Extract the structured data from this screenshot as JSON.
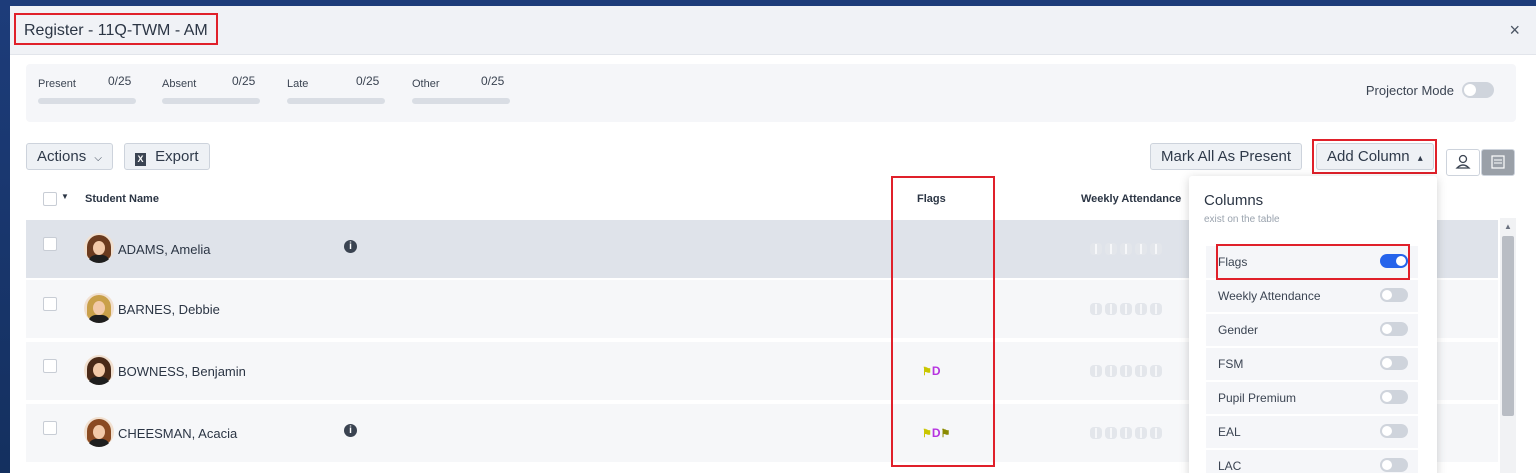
{
  "modal": {
    "title": "Register - 11Q-TWM - AM",
    "close_glyph": "×"
  },
  "stats": [
    {
      "label": "Present",
      "value": "0/25",
      "fill_fraction": 0
    },
    {
      "label": "Absent",
      "value": "0/25",
      "fill_fraction": 0
    },
    {
      "label": "Late",
      "value": "0/25",
      "fill_fraction": 0
    },
    {
      "label": "Other",
      "value": "0/25",
      "fill_fraction": 0
    }
  ],
  "projector": {
    "label": "Projector Mode",
    "enabled": false
  },
  "toolbar": {
    "actions_label": "Actions",
    "export_label": "Export",
    "mark_all_label": "Mark All As Present",
    "add_column_label": "Add Column"
  },
  "table": {
    "headers": {
      "name": "Student Name",
      "flags": "Flags",
      "weekly": "Weekly Attendance"
    },
    "rows": [
      {
        "name": "ADAMS, Amelia",
        "info": true,
        "flags": [],
        "selected": true,
        "hair": "#6b3b1f"
      },
      {
        "name": "BARNES, Debbie",
        "info": false,
        "flags": [],
        "selected": false,
        "hair": "#c9a04a"
      },
      {
        "name": "BOWNESS, Benjamin",
        "info": false,
        "flags": [
          {
            "type": "flag",
            "color": "#c9c600"
          },
          {
            "type": "text",
            "text": "D",
            "color": "#b634e0"
          }
        ],
        "selected": false,
        "hair": "#4a2a18"
      },
      {
        "name": "CHEESMAN, Acacia",
        "info": true,
        "flags": [
          {
            "type": "flag",
            "color": "#c9c600"
          },
          {
            "type": "text",
            "text": "D",
            "color": "#b634e0"
          },
          {
            "type": "flag",
            "color": "#8a8a00"
          }
        ],
        "selected": false,
        "hair": "#8a4a22"
      }
    ]
  },
  "columns_panel": {
    "title": "Columns",
    "subtitle": "exist on the table",
    "items": [
      {
        "label": "Flags",
        "enabled": true
      },
      {
        "label": "Weekly Attendance",
        "enabled": false
      },
      {
        "label": "Gender",
        "enabled": false
      },
      {
        "label": "FSM",
        "enabled": false
      },
      {
        "label": "Pupil Premium",
        "enabled": false
      },
      {
        "label": "EAL",
        "enabled": false
      },
      {
        "label": "LAC",
        "enabled": false
      }
    ]
  },
  "colors": {
    "accent": "#2563eb",
    "highlight_box": "#e0202a",
    "flag_yellow": "#c9c600",
    "flag_d": "#b634e0"
  },
  "icons": {
    "close": "close-icon",
    "info": "info-icon",
    "excel": "excel-icon",
    "person": "person-icon",
    "list": "list-view-icon"
  }
}
